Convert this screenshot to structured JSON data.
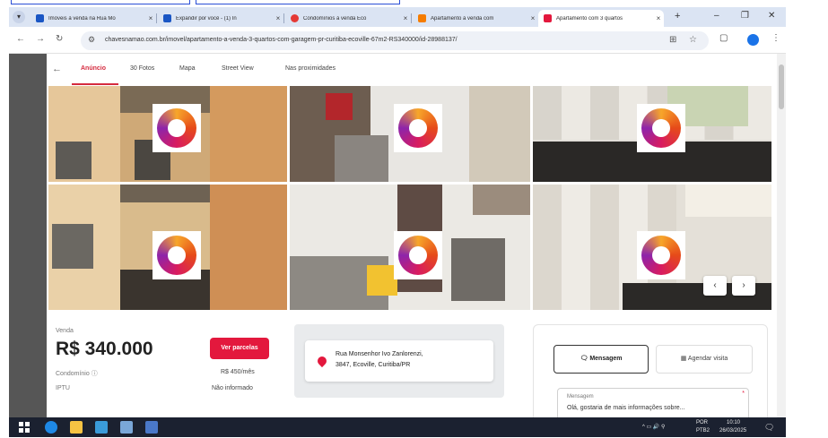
{
  "browser": {
    "tabs": [
      {
        "label": "Imóveis à venda na Rua Mo",
        "active": false,
        "favicon_color": "#1a56c4"
      },
      {
        "label": "Expandir por você - (1) In",
        "active": false,
        "favicon_color": "#1a56c4"
      },
      {
        "label": "Condomínios à venda Eco",
        "active": false,
        "favicon_color": "#e53935"
      },
      {
        "label": "Apartamento à venda com",
        "active": false,
        "favicon_color": "#f57c00"
      },
      {
        "label": "Apartamento com 3 quartos",
        "active": true,
        "favicon_color": "#e3183d"
      }
    ],
    "new_tab": "+",
    "close_glyph": "×",
    "window_controls": {
      "minimize": "–",
      "restore": "❐",
      "close": "✕"
    },
    "url": "chavesnamao.com.br/imovel/apartamento-a-venda-3-quartos-com-garagem-pr-curitiba-ecoville-67m2-RS340000/id-28988137/"
  },
  "page": {
    "nav_tabs": [
      "Anúncio",
      "30 Fotos",
      "Mapa",
      "Street View",
      "Nas proximidades"
    ],
    "active_tab": "Anúncio",
    "gallery": {
      "prev": "‹",
      "next": "›"
    },
    "listing": {
      "transaction_label": "Venda",
      "price": "R$ 340.000",
      "installments_button": "Ver parcelas",
      "condo_label": "Condomínio",
      "condo_value": "R$ 450/mês",
      "iptu_label": "IPTU",
      "iptu_value": "Não informado"
    },
    "address": {
      "line1": "Rua Monsenhor Ivo Zanlorenzi,",
      "line2": "3847, Ecoville, Curitiba/PR"
    },
    "contact": {
      "message_button": "Mensagem",
      "schedule_button": "Agendar visita",
      "message_field_label": "Mensagem",
      "message_field_value": "Olá, gostaria de mais informações sobre...",
      "required_mark": "*"
    }
  },
  "taskbar": {
    "language": "POR",
    "layout": "PTB2",
    "time": "10:10",
    "date": "26/03/2025"
  }
}
